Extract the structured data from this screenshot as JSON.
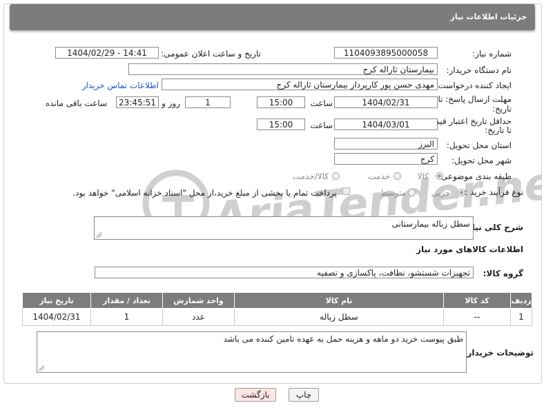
{
  "header": {
    "title": "جزئیات اطلاعات نیاز"
  },
  "form": {
    "need_number_label": "شماره نیاز:",
    "need_number": "1104093895000058",
    "announce_label": "تاریخ و ساعت اعلان عمومی:",
    "announce_value": "1404/02/29 - 14:41",
    "buyer_org_label": "نام دستگاه خریدار:",
    "buyer_org": "بیمارستان ثاراله کرج",
    "creator_label": "ایجاد کننده درخواست:",
    "creator": "مهدی حسن پور کارپرداز بیمارستان ثاراله کرج",
    "buyer_contact_link": "اطلاعات تماس خریدار",
    "reply_deadline_label_1": "مهلت ارسال پاسخ: تا",
    "reply_deadline_label_2": "تاریخ:",
    "reply_date": "1404/02/31",
    "time_label": "ساعت",
    "reply_time": "15:00",
    "days_value": "1",
    "days_label": "روز و",
    "remaining_value": "23:45:51",
    "remaining_label": "ساعت باقی مانده",
    "price_validity_label_1": "حداقل تاریخ اعتبار قیمت:",
    "price_validity_label_2": "تا تاریخ:",
    "price_date": "1404/03/01",
    "price_time": "15:00",
    "province_label": "استان محل تحویل:",
    "province": "البرز",
    "city_label": "شهر محل تحویل:",
    "city": "کرج",
    "category_label": "طبقه بندی موضوعی:",
    "category_options": [
      "کالا",
      "خدمت",
      "کالا/خدمت"
    ],
    "process_label": "نوع فرآیند خرید :",
    "process_options": [
      "جزیی",
      "متوسط"
    ],
    "payment_note": "پرداخت تمام یا بخشی از مبلغ خرید،از محل \"اسناد خزانه اسلامی\" خواهد بود.",
    "summary_label": "شرح کلی نیاز:",
    "summary": "سطل زباله بیمارستانی",
    "goods_info_title": "اطلاعات کالاهای مورد نیاز",
    "goods_group_label": "گروه کالا:",
    "goods_group": "تجهیزات شستشو، نظافت، پاکسازی و تصفیه",
    "buyer_notes_label": "توضیحات خریدار:",
    "buyer_notes": "طبق پیوست خرید دو ماهه و هزینه حمل به عهده تامین کننده می باشد"
  },
  "table": {
    "columns": [
      "ردیف",
      "کد کالا",
      "نام کالا",
      "واحد شمارش",
      "تعداد / مقدار",
      "تاریخ نیاز"
    ],
    "rows": [
      [
        "1",
        "--",
        "سطل زباله",
        "عدد",
        "1",
        "1404/02/31"
      ]
    ]
  },
  "buttons": {
    "print": "چاپ",
    "back": "بازگشت"
  },
  "watermark": {
    "text": "AriaTender.neT"
  },
  "colors": {
    "header_bg": "#7c7c7c",
    "link": "#1a55c9",
    "back_button_bg": "#fde4e4",
    "watermark": "#c9c9c9"
  }
}
